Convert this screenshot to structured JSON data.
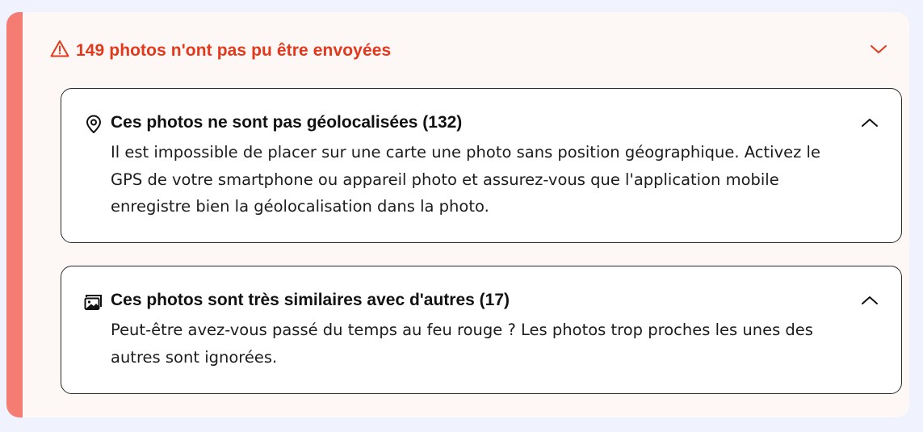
{
  "alert": {
    "title": "149 photos n'ont pas pu être envoyées",
    "icon": "warning-triangle-icon",
    "toggle_icon": "chevron-down-icon",
    "accent_color": "#e3381b",
    "bar_color": "#f47c73"
  },
  "sections": [
    {
      "icon": "location-pin-icon",
      "title": "Ces photos ne sont pas géolocalisées (132)",
      "description": "Il est impossible de placer sur une carte une photo sans position géographique. Activez le GPS de votre smartphone ou appareil photo et assurez-vous que l'application mobile enregistre bien la géolocalisation dans la photo.",
      "toggle_icon": "chevron-up-icon"
    },
    {
      "icon": "photos-icon",
      "title": "Ces photos sont très similaires avec d'autres (17)",
      "description": "Peut-être avez-vous passé du temps au feu rouge ? Les photos trop proches les unes des autres sont ignorées.",
      "toggle_icon": "chevron-up-icon"
    }
  ]
}
